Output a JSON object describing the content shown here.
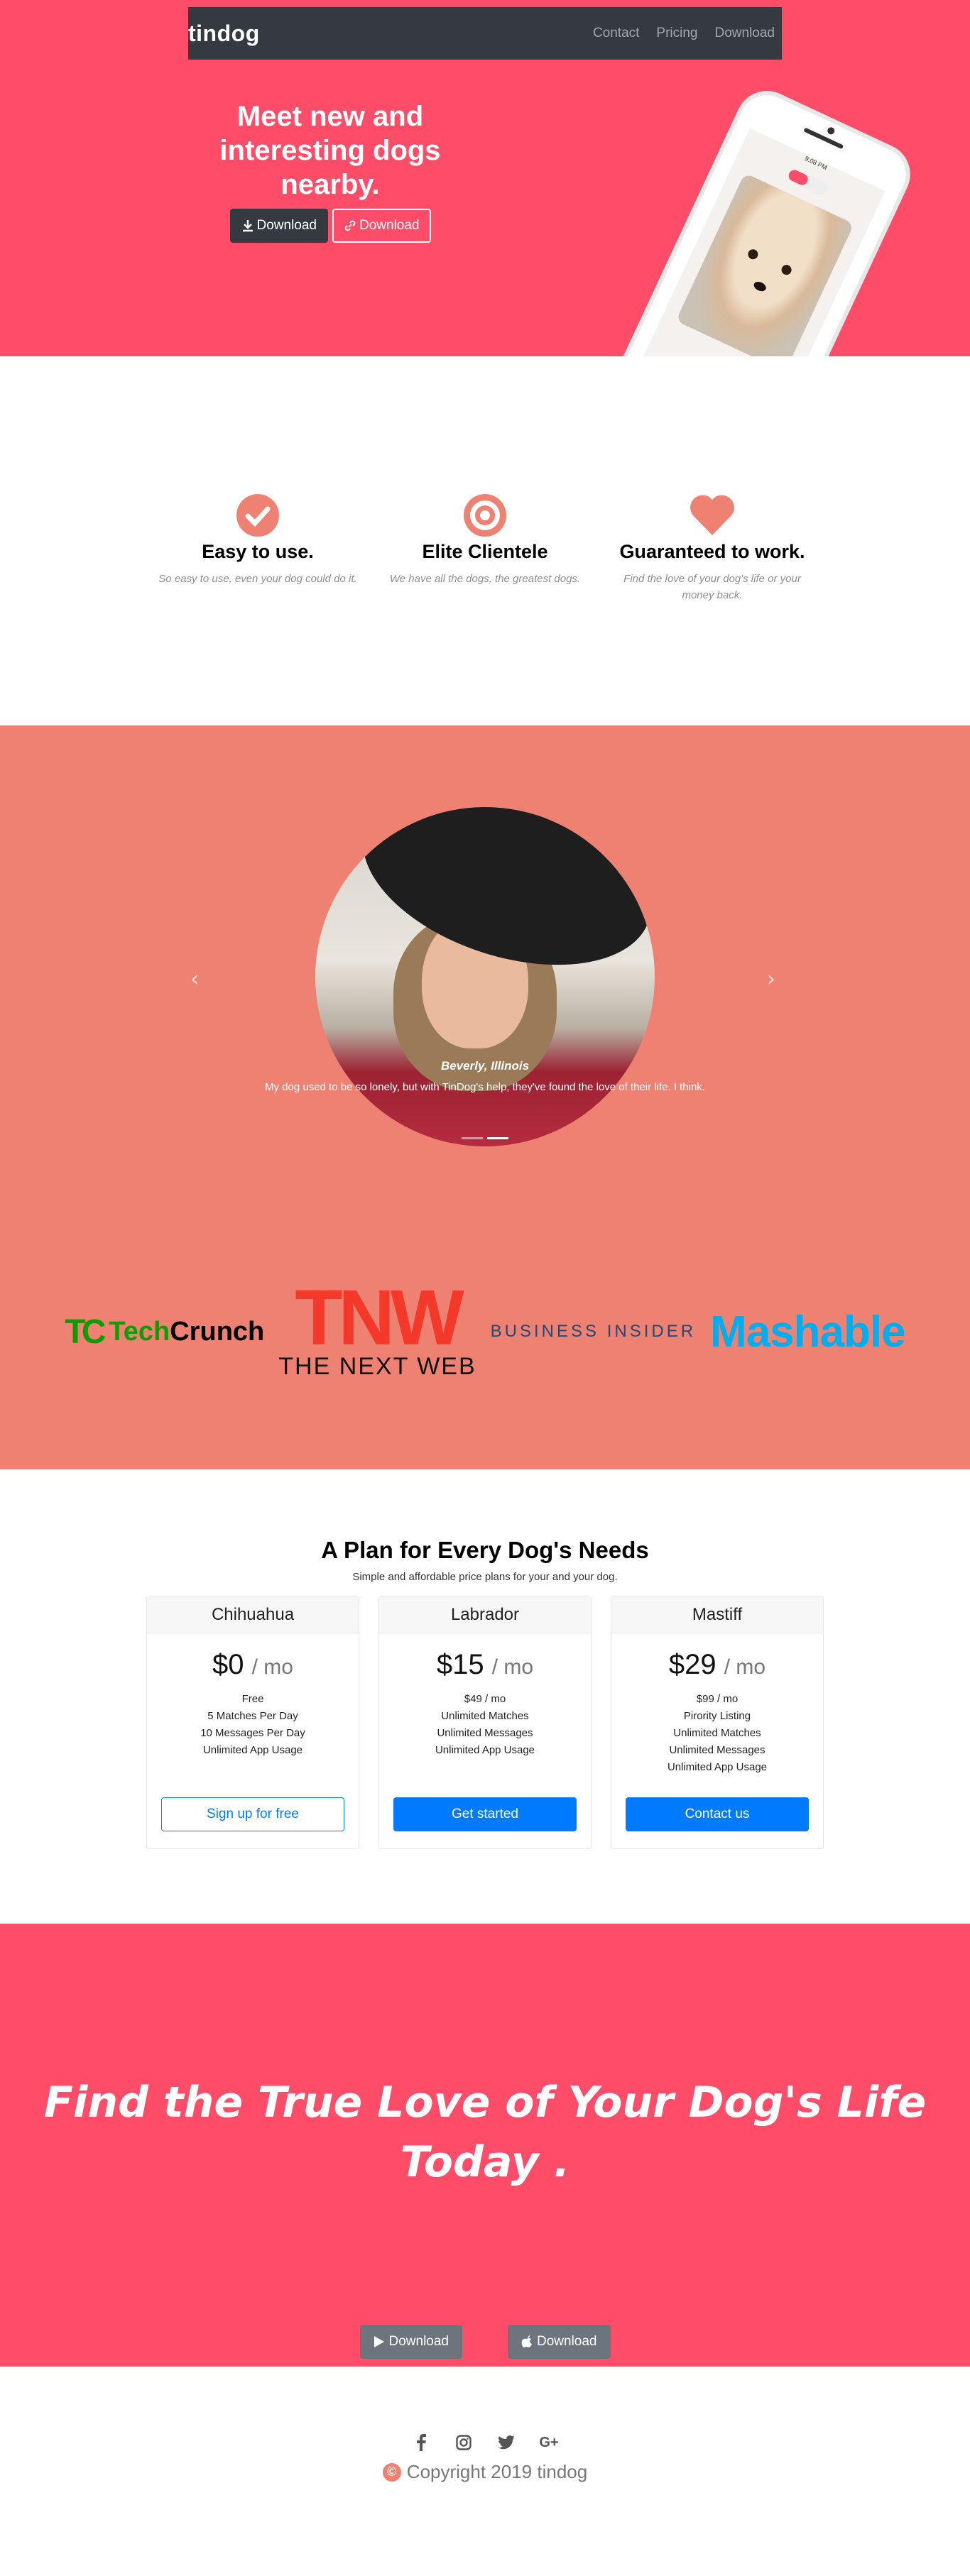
{
  "colors": {
    "primary": "#ff4c68",
    "secondary": "#ef8172",
    "dark": "#343a40",
    "blue": "#007bff",
    "grey": "#6c757d"
  },
  "navbar": {
    "brand": "tindog",
    "links": [
      "Contact",
      "Pricing",
      "Download"
    ]
  },
  "hero": {
    "title": "Meet new and interesting dogs nearby.",
    "download_apple": "Download",
    "download_google": "Download",
    "phone_status_time": "9:08 PM"
  },
  "features": [
    {
      "icon": "check-circle-icon",
      "title": "Easy to use.",
      "text": "So easy to use, even your dog could do it."
    },
    {
      "icon": "bullseye-icon",
      "title": "Elite Clientele",
      "text": "We have all the dogs, the greatest dogs."
    },
    {
      "icon": "heart-icon",
      "title": "Guaranteed to work.",
      "text": "Find the love of your dog's life or your money back."
    }
  ],
  "testimonial": {
    "name": "Beverly, Illinois",
    "quote": "My dog used to be so lonely, but with TinDog's help, they've found the love of their life. I think."
  },
  "press": {
    "techcrunch_mark": "TC",
    "techcrunch_a": "Tech",
    "techcrunch_b": "Crunch",
    "tnw_mark": "TNW",
    "tnw_sub": "THE NEXT WEB",
    "business_insider": "BUSINESS INSIDER",
    "mashable": "Mashable"
  },
  "pricing": {
    "title": "A Plan for Every Dog's Needs",
    "subtitle": "Simple and affordable price plans for your and your dog.",
    "plans": [
      {
        "name": "Chihuahua",
        "price": "$0",
        "unit": "/ mo",
        "features": [
          "Free",
          "5 Matches Per Day",
          "10 Messages Per Day",
          "Unlimited App Usage"
        ],
        "button": "Sign up for free"
      },
      {
        "name": "Labrador",
        "price": "$15",
        "unit": "/ mo",
        "features": [
          "$49 / mo",
          "Unlimited Matches",
          "Unlimited Messages",
          "Unlimited App Usage"
        ],
        "button": "Get started"
      },
      {
        "name": "Mastiff",
        "price": "$29",
        "unit": "/ mo",
        "features": [
          "$99 / mo",
          "Pirority Listing",
          "Unlimited Matches",
          "Unlimited Messages",
          "Unlimited App Usage"
        ],
        "button": "Contact us"
      }
    ]
  },
  "cta": {
    "title": "Find the True Love of Your Dog's Life Today .",
    "download_google": "Download",
    "download_apple": "Download"
  },
  "footer": {
    "social": [
      "facebook-icon",
      "instagram-icon",
      "twitter-icon",
      "google-plus-icon"
    ],
    "copyright": "Copyright 2019 tindog"
  }
}
